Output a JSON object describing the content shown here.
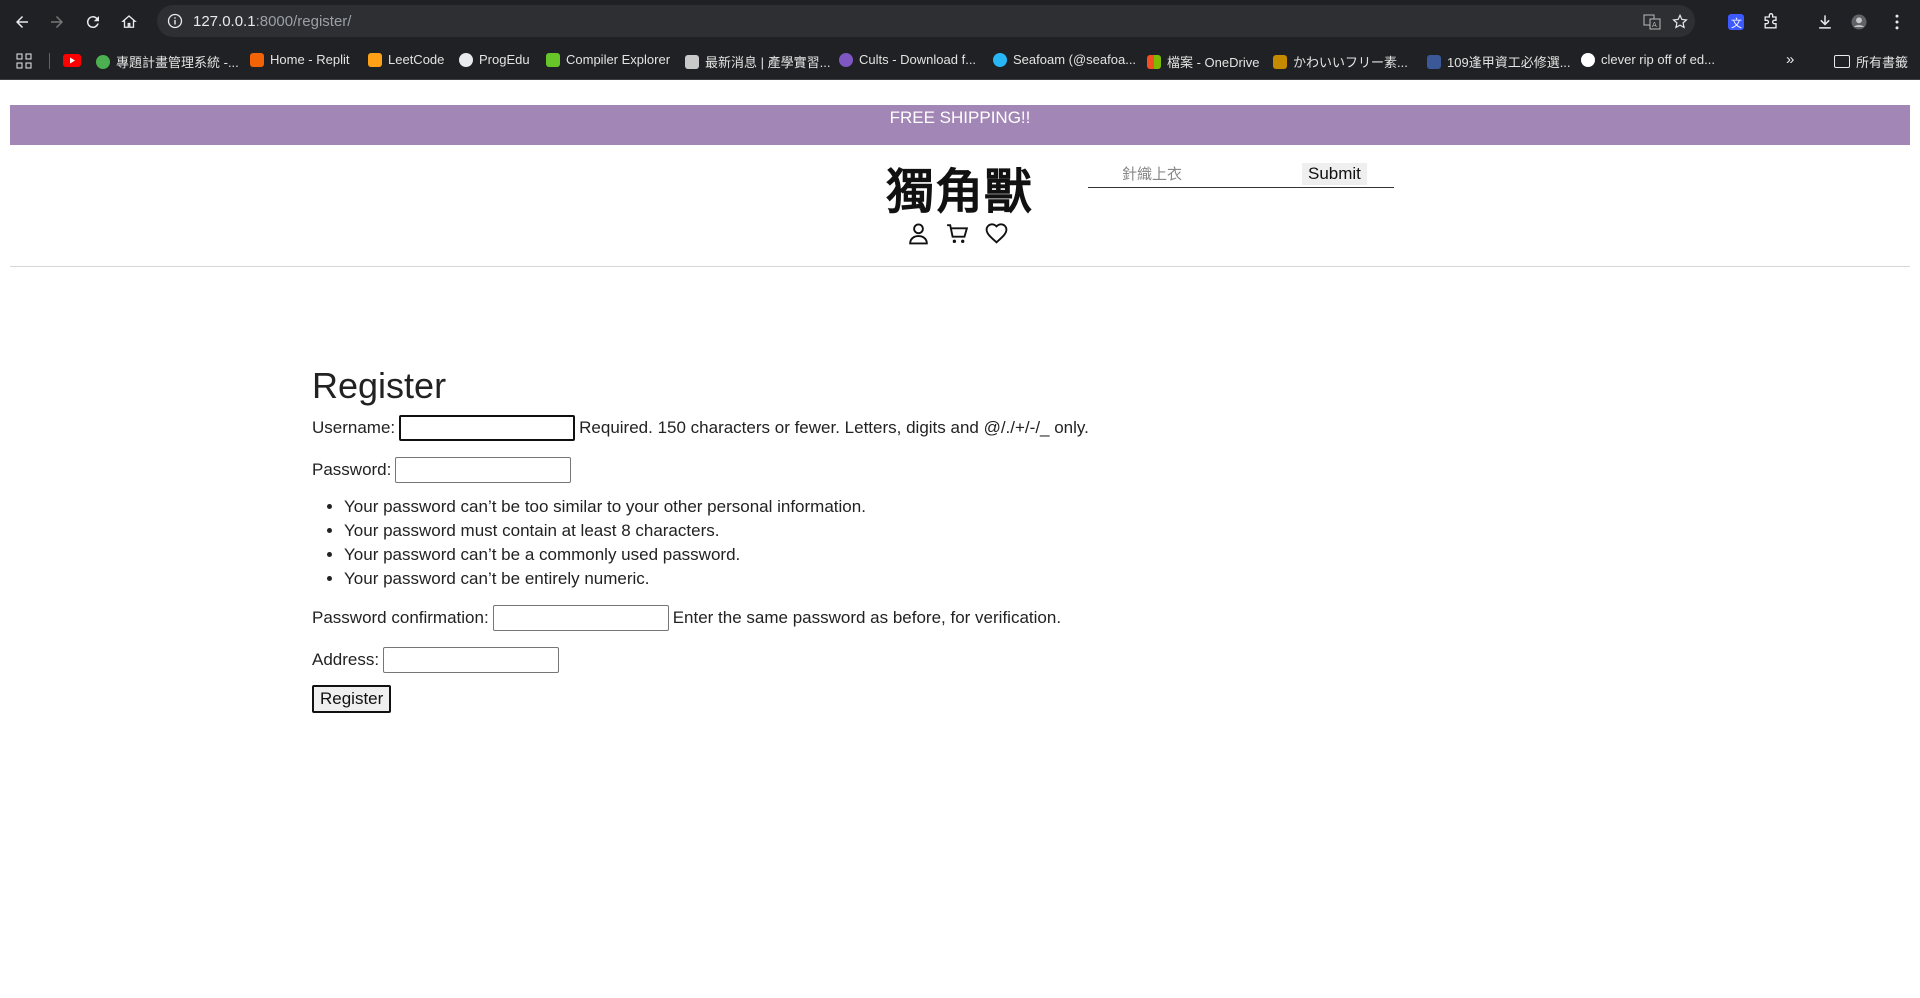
{
  "browser": {
    "url_host": "127.0.0.1",
    "url_path": ":8000/register/",
    "bookmarks": [
      {
        "label": "專題計畫管理系統 -...",
        "color": "#4caf50"
      },
      {
        "label": "Home - Replit",
        "color": "#f26207"
      },
      {
        "label": "LeetCode",
        "color": "#ffa116"
      },
      {
        "label": "ProgEdu",
        "color": "#e8eaed"
      },
      {
        "label": "Compiler Explorer",
        "color": "#67c52a"
      },
      {
        "label": "最新消息 | 產學實習...",
        "color": "#c9c9c9"
      },
      {
        "label": "Cults - Download f...",
        "color": "#7e57c2"
      },
      {
        "label": "Seafoam (@seafoa...",
        "color": "#29b6f6"
      },
      {
        "label": "檔案 - OneDrive",
        "color": "#f25022"
      },
      {
        "label": "かわいいフリー素...",
        "color": "#c58b00"
      },
      {
        "label": "109逢甲資工必修選...",
        "color": "#3b5998"
      },
      {
        "label": "clever rip off of ed...",
        "color": "#ffffff"
      }
    ],
    "all_bookmarks_label": "所有書籤"
  },
  "promo": {
    "text": "FREE SHIPPING!!",
    "color": "#a287b6"
  },
  "header": {
    "logo": "獨角獸",
    "search_placeholder": "針織上衣",
    "search_button": "Submit"
  },
  "form": {
    "title": "Register",
    "username_label": "Username:",
    "username_help": "Required. 150 characters or fewer. Letters, digits and @/./+/-/_ only.",
    "password_label": "Password:",
    "password_rules": [
      "Your password can’t be too similar to your other personal information.",
      "Your password must contain at least 8 characters.",
      "Your password can’t be a commonly used password.",
      "Your password can’t be entirely numeric."
    ],
    "confirm_label": "Password confirmation:",
    "confirm_help": "Enter the same password as before, for verification.",
    "address_label": "Address:",
    "submit_label": "Register"
  }
}
